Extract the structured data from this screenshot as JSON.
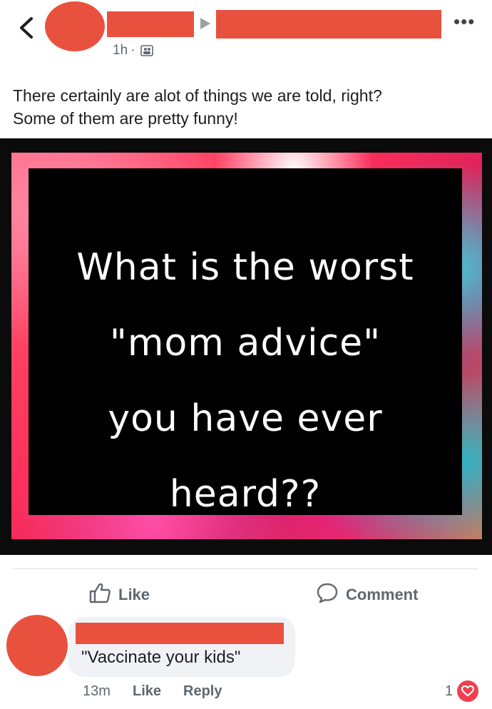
{
  "header": {
    "time": "1h",
    "separator": "·"
  },
  "post": {
    "text": "There certainly are alot of things we are told, right?\nSome of them are pretty funny!",
    "image_text": "What is the worst\n\"mom advice\"\nyou have ever\nheard??"
  },
  "actions": {
    "like_label": "Like",
    "comment_label": "Comment"
  },
  "comment": {
    "text": "\"Vaccinate your kids\"",
    "time": "13m",
    "like_label": "Like",
    "reply_label": "Reply",
    "reaction_count": "1"
  },
  "colors": {
    "redaction": "#e9513f",
    "reaction_heart": "#f04050",
    "meta_text": "#606770"
  },
  "icons": [
    "back-chevron-icon",
    "triangle-arrow-icon",
    "more-dots-icon",
    "audience-icon",
    "thumbs-up-icon",
    "comment-bubble-icon",
    "heart-icon"
  ]
}
